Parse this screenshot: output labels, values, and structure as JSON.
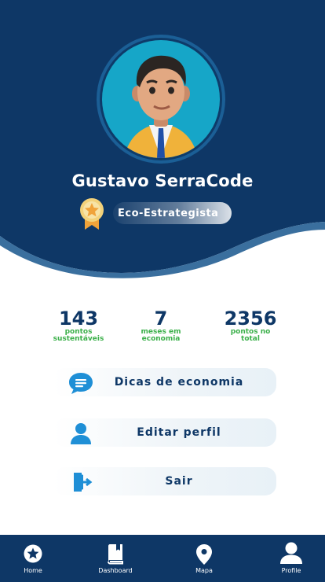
{
  "profile": {
    "name": "Gustavo SerraCode",
    "badge": "Eco-Estrategista"
  },
  "stats": [
    {
      "value": "143",
      "label_line1": "pontos",
      "label_line2": "sustentáveis"
    },
    {
      "value": "7",
      "label_line1": "meses em",
      "label_line2": "economia"
    },
    {
      "value": "2356",
      "label_line1": "pontos no",
      "label_line2": "total"
    }
  ],
  "menu": {
    "tips": "Dicas de economia",
    "edit_profile": "Editar perfil",
    "logout": "Sair"
  },
  "nav": {
    "home": "Home",
    "dashboard": "Dashboard",
    "map": "Mapa",
    "profile": "Profile"
  },
  "colors": {
    "primary": "#0e3766",
    "accent_green": "#3bb04a",
    "avatar_bg": "#16a6c8",
    "icon_blue": "#1f8fd6"
  },
  "icons": {
    "badge": "medal-icon",
    "tips": "chat-bubble-icon",
    "edit_profile": "person-icon",
    "logout": "exit-door-icon",
    "nav_home": "star-circle-icon",
    "nav_dashboard": "book-icon",
    "nav_map": "map-pin-icon",
    "nav_profile": "user-icon"
  }
}
